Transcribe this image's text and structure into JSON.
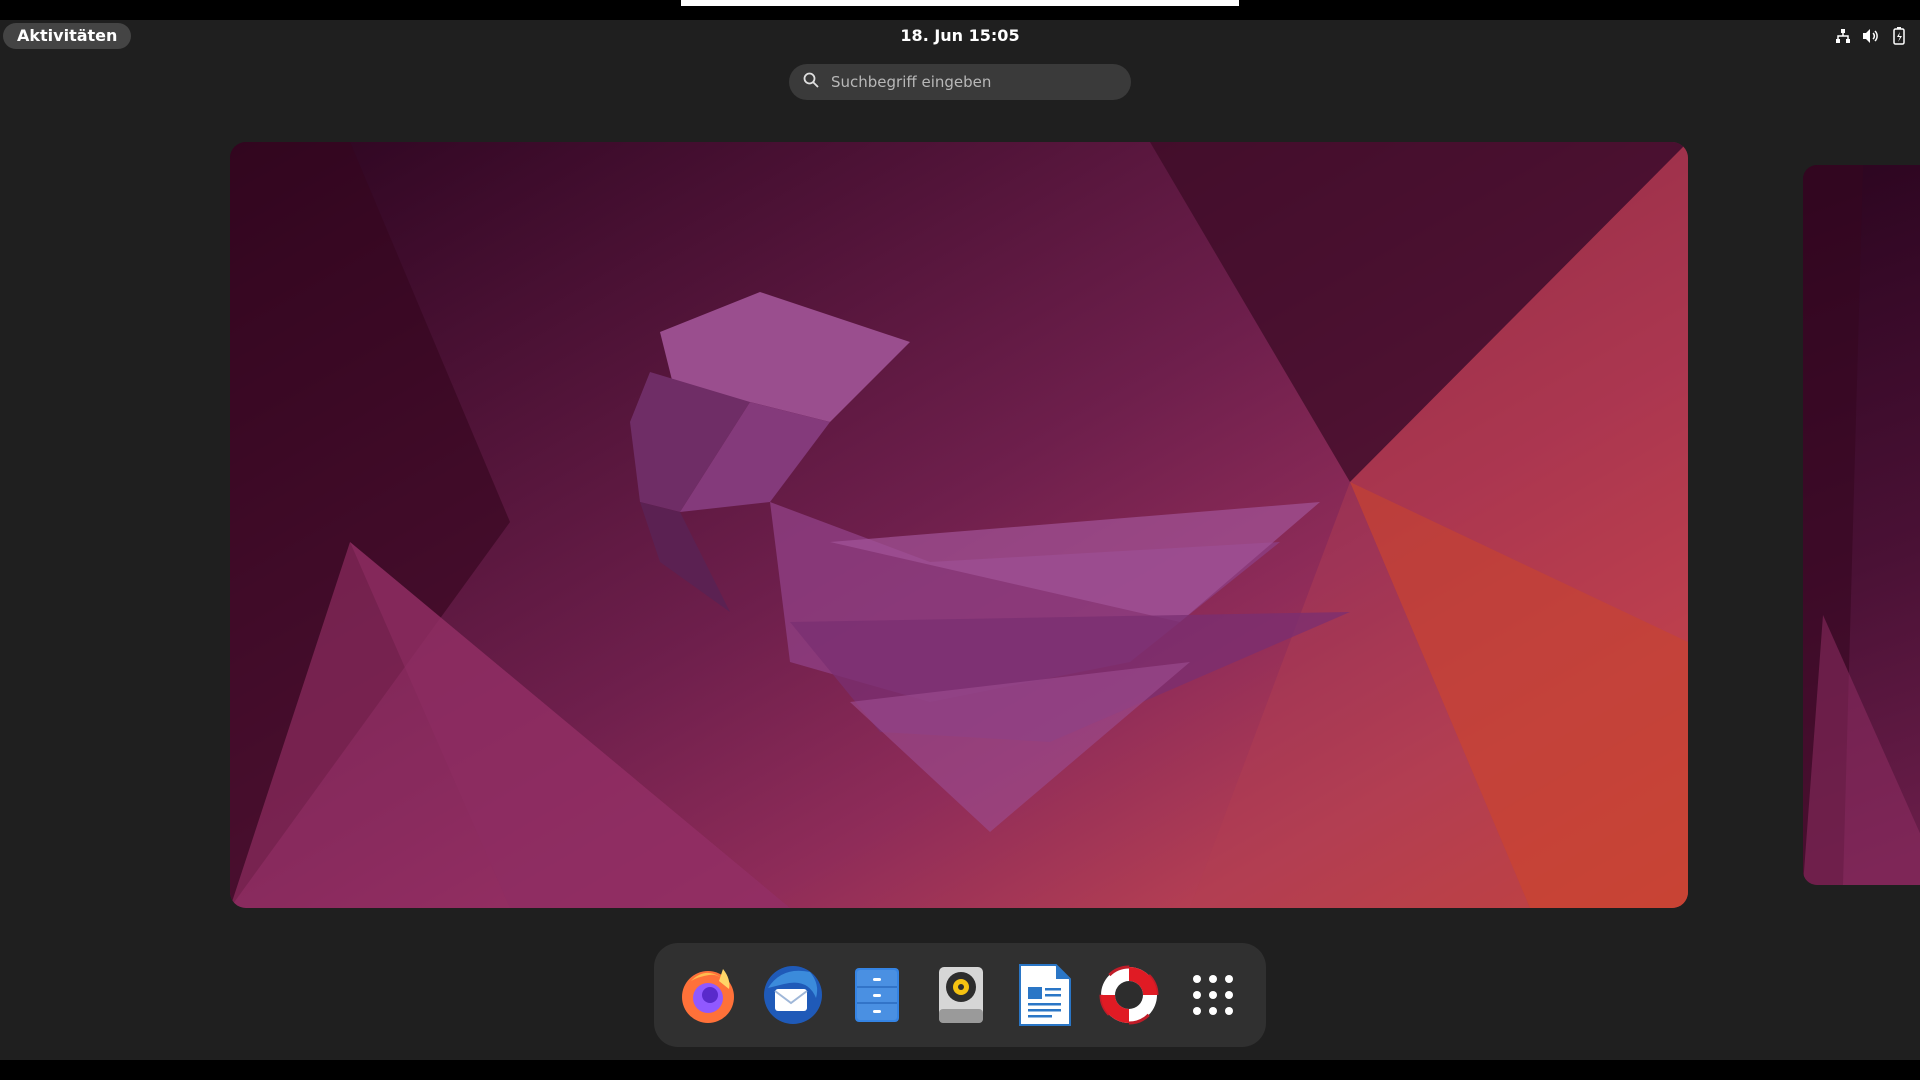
{
  "topbar": {
    "activities_label": "Aktivitäten",
    "clock": "18. Jun 15:05",
    "tray_icons": [
      "network-icon",
      "volume-icon",
      "battery-icon"
    ]
  },
  "search": {
    "placeholder": "Suchbegriff eingeben",
    "icon": "search-icon"
  },
  "workspaces": [
    {
      "name": "workspace-1",
      "active": true
    },
    {
      "name": "workspace-2",
      "active": false
    }
  ],
  "dock": {
    "items": [
      {
        "name": "firefox",
        "icon": "firefox-icon"
      },
      {
        "name": "thunderbird",
        "icon": "thunderbird-icon"
      },
      {
        "name": "files",
        "icon": "files-icon"
      },
      {
        "name": "rhythmbox",
        "icon": "rhythmbox-icon"
      },
      {
        "name": "libreoffice-writer",
        "icon": "writer-icon"
      },
      {
        "name": "help",
        "icon": "help-icon"
      },
      {
        "name": "show-applications",
        "icon": "app-grid-icon"
      }
    ]
  },
  "colors": {
    "panel": "#1f1f1f",
    "wallpaper_dark": "#2c0520",
    "wallpaper_mid": "#8f2c59",
    "wallpaper_orange": "#d0472f",
    "dock_bg": "#303030"
  }
}
